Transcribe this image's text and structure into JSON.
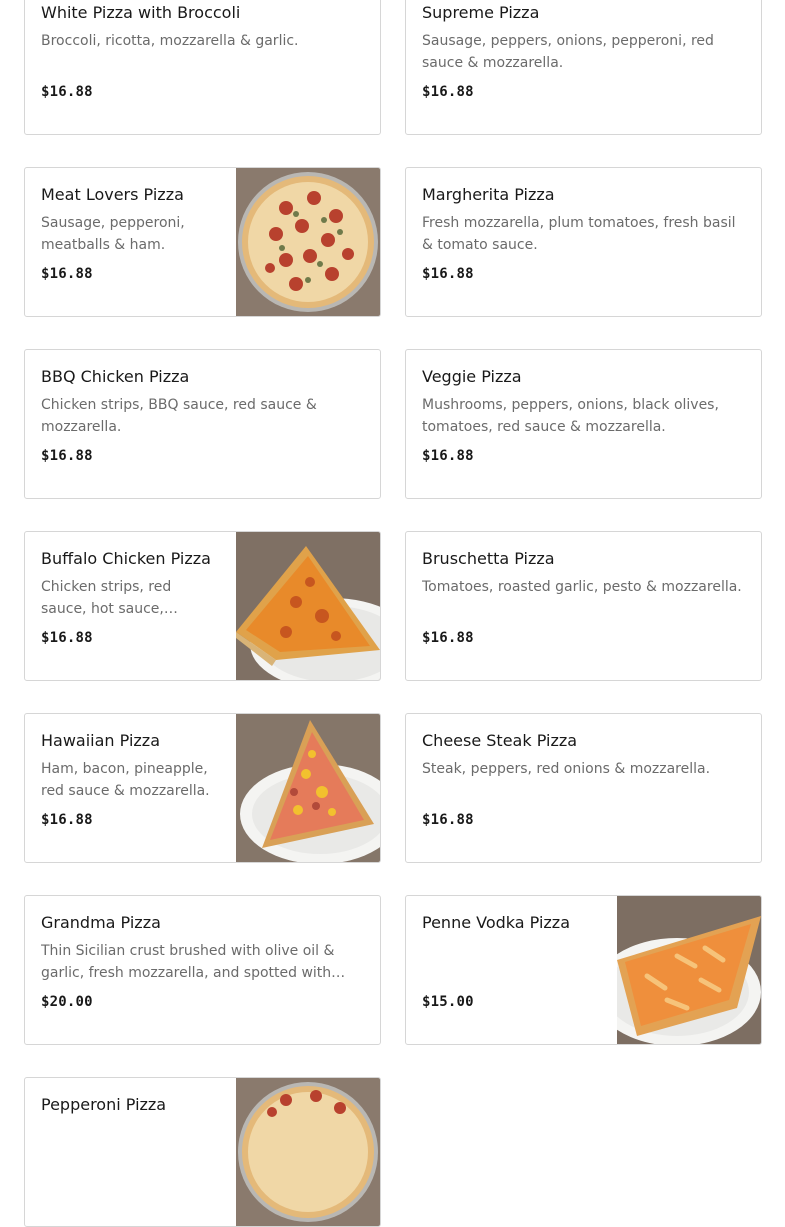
{
  "menu": {
    "items": [
      {
        "name": "White Pizza with Broccoli",
        "description": "Broccoli, ricotta, mozzarella & garlic.",
        "price": "$16.88",
        "image": null
      },
      {
        "name": "Supreme Pizza",
        "description": "Sausage, peppers, onions, pepperoni, red sauce & mozzarella.",
        "price": "$16.88",
        "image": null
      },
      {
        "name": "Meat Lovers Pizza",
        "description": "Sausage, pepperoni, meatballs & ham.",
        "price": "$16.88",
        "image": "whole-pizza-photo"
      },
      {
        "name": "Margherita Pizza",
        "description": "Fresh mozzarella, plum tomatoes, fresh basil & tomato sauce.",
        "price": "$16.88",
        "image": null
      },
      {
        "name": "BBQ Chicken Pizza",
        "description": "Chicken strips, BBQ sauce, red sauce & mozzarella.",
        "price": "$16.88",
        "image": null
      },
      {
        "name": "Veggie Pizza",
        "description": "Mushrooms, peppers, onions, black olives, tomatoes, red sauce & mozzarella.",
        "price": "$16.88",
        "image": null
      },
      {
        "name": "Buffalo Chicken Pizza",
        "description": "Chicken strips, red sauce, hot sauce, mozzarella &…",
        "price": "$16.88",
        "image": "pizza-slice-photo"
      },
      {
        "name": "Bruschetta Pizza",
        "description": "Tomatoes, roasted garlic, pesto & mozzarella.",
        "price": "$16.88",
        "image": null
      },
      {
        "name": "Hawaiian Pizza",
        "description": "Ham, bacon, pineapple, red sauce & mozzarella.",
        "price": "$16.88",
        "image": "pizza-slice-photo"
      },
      {
        "name": "Cheese Steak Pizza",
        "description": "Steak, peppers, red onions & mozzarella.",
        "price": "$16.88",
        "image": null
      },
      {
        "name": "Grandma Pizza",
        "description": "Thin Sicilian crust brushed with olive oil & garlic, fresh mozzarella, and spotted with chunky San…",
        "price": "$20.00",
        "image": null
      },
      {
        "name": "Penne Vodka Pizza",
        "description": "",
        "price": "$15.00",
        "image": "pizza-slice-photo"
      },
      {
        "name": "Pepperoni Pizza",
        "description": "",
        "price": "",
        "image": "whole-pizza-photo"
      }
    ]
  },
  "colors": {
    "border": "#d6d6d6",
    "text_primary": "#191919",
    "text_secondary": "#6b6b6b",
    "plate": "#f4f4f2",
    "table_surface": "#8a7a6d"
  }
}
